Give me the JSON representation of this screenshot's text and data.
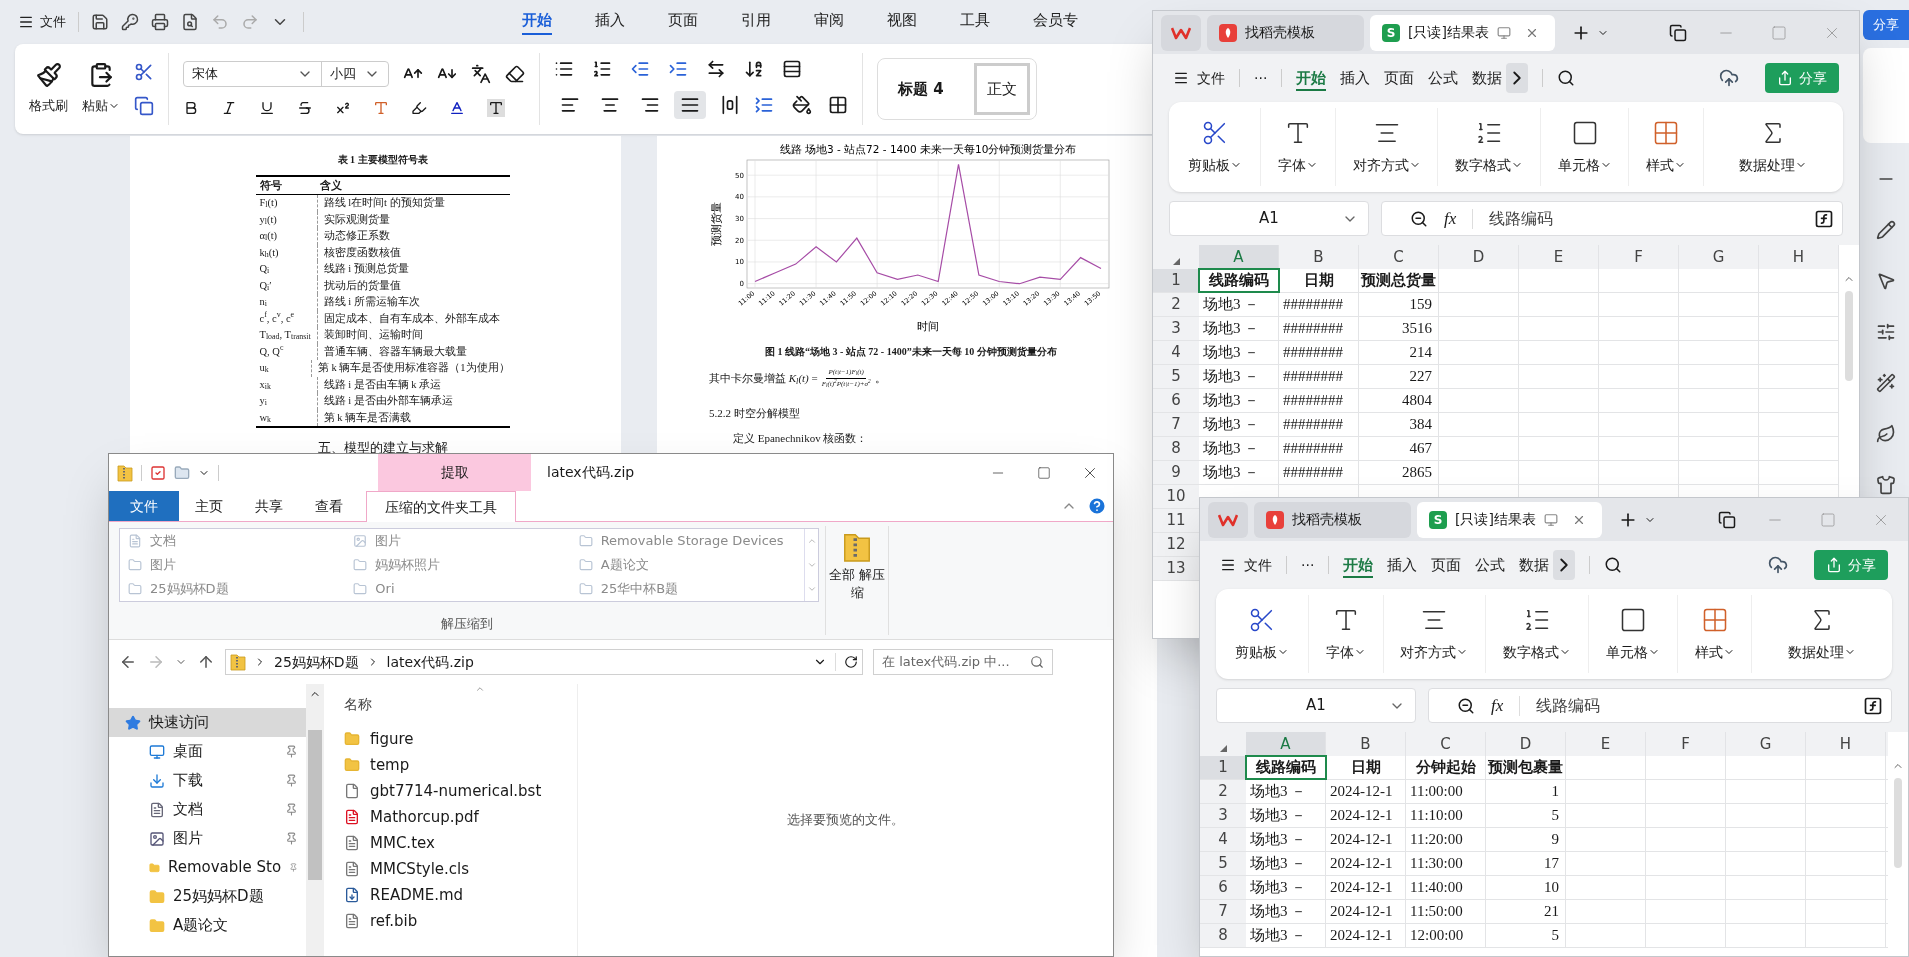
{
  "writer": {
    "menu": "文件",
    "tabs": [
      {
        "label": "开始",
        "selected": true
      },
      {
        "label": "插入",
        "selected": false
      },
      {
        "label": "页面",
        "selected": false
      },
      {
        "label": "引用",
        "selected": false
      },
      {
        "label": "审阅",
        "selected": false
      },
      {
        "label": "视图",
        "selected": false
      },
      {
        "label": "工具",
        "selected": false
      },
      {
        "label": "会员专",
        "selected": false
      }
    ],
    "clipboard": {
      "format_painter": "格式刷",
      "paste": "粘贴"
    },
    "font": "宋体",
    "size": "小四",
    "align_buttons": [
      {
        "kind": "left",
        "selected": false
      },
      {
        "kind": "center",
        "selected": false
      },
      {
        "kind": "right",
        "selected": false
      },
      {
        "kind": "justify",
        "selected": true
      },
      {
        "kind": "distributed",
        "selected": false
      }
    ],
    "styles": [
      "标题 4",
      "正文"
    ],
    "share": "分享",
    "page1": {
      "caption": "表 1  主要模型符号表",
      "columns": [
        "符号",
        "含义"
      ],
      "rows": [
        {
          "symbol": "F$_{l}$(t)",
          "meaning": "路线 l在时间t 的预知货量"
        },
        {
          "symbol": "y$_{l}$(t)",
          "meaning": "实际观测货量"
        },
        {
          "symbol": "α$_{l}$(t)",
          "meaning": "动态修正系数"
        },
        {
          "symbol": "k$_{h}$(t)",
          "meaning": "核密度函数核值"
        },
        {
          "symbol": "Q$_{i}$",
          "meaning": "线路 i 预测总货量"
        },
        {
          "symbol": "Q$_{i}$′",
          "meaning": "扰动后的货量值"
        },
        {
          "symbol": "n$_{i}$",
          "meaning": "路线 i 所需运输车次"
        },
        {
          "symbol": "c$^{f}$, c$^{v}$, c$^{e}$",
          "meaning": "固定成本、自有车成本、外部车成本"
        },
        {
          "symbol": "T$_{load}$, T$_{transit}$",
          "meaning": "装卸时间、运输时间"
        },
        {
          "symbol": "Q, Q$^{c}$",
          "meaning": "普通车辆、容器车辆最大载量"
        },
        {
          "symbol": "u$_{k}$",
          "meaning": "第 k 辆车是否使用标准容器（1为使用）"
        },
        {
          "symbol": "x$_{ik}$",
          "meaning": "线路 i 是否由车辆 k 承运"
        },
        {
          "symbol": "y$_{i}$",
          "meaning": "线路 i 是否由外部车辆承运"
        },
        {
          "symbol": "w$_{k}$",
          "meaning": "第 k 辆车是否满载"
        }
      ],
      "heading": "五、模型的建立与求解"
    },
    "page2": {
      "chart_data": {
        "type": "line",
        "title": "线路 场地3 - 站点72 - 1400 未来一天每10分钟预测货量分布",
        "xlabel": "时间",
        "ylabel": "预测货量",
        "categories": [
          "11:00",
          "11:10",
          "11:20",
          "11:30",
          "11:40",
          "11:50",
          "12:00",
          "12:10",
          "12:20",
          "12:30",
          "12:40",
          "12:50",
          "13:00",
          "13:10",
          "13:20",
          "13:30",
          "13:40",
          "13:50"
        ],
        "series": [
          {
            "color": "#a64ca6",
            "values": [
              1,
              5,
              9,
              17,
              10,
              21,
              5,
              2,
              4,
              1,
              55,
              4,
              1,
              0,
              3,
              2,
              12,
              7
            ]
          }
        ],
        "ylim": [
          -2,
          57
        ],
        "yticks": [
          0,
          10,
          20,
          30,
          40,
          50
        ],
        "grid": true
      },
      "caption": "图 1 线路“场地 3 - 站点 72 - 1400”未来一天每 10 分钟预测货量分布",
      "kalman_lead": "其中卡尔曼增益 *K$_{l}$(t)* =",
      "numerator": "P(t|t−1)F$_{l}$(t)",
      "denominator": "F$_{l}$(t)$^{2}$P(t|t−1)+σ$^{2}$",
      "kalman_end": "。",
      "section": "5.2.2 时空分解模型",
      "definition": "定义 Epanechnikov 核函数："
    }
  },
  "explorer": {
    "title": "latex代码.zip",
    "context_tab": "提取",
    "tabs": [
      {
        "label": "文件",
        "kind": "file_menu",
        "selected": false
      },
      {
        "label": "主页",
        "kind": "tab",
        "selected": false
      },
      {
        "label": "共享",
        "kind": "tab",
        "selected": false
      },
      {
        "label": "查看",
        "kind": "tab",
        "selected": false
      },
      {
        "label": "压缩的文件夹工具",
        "kind": "tab",
        "selected": true
      }
    ],
    "locations": [
      {
        "label": "文档",
        "kind": "document"
      },
      {
        "label": "图片",
        "kind": "picture"
      },
      {
        "label": "Removable Storage Devices",
        "kind": "folder"
      },
      {
        "label": "图片",
        "kind": "folder"
      },
      {
        "label": "妈妈杯照片",
        "kind": "folder"
      },
      {
        "label": "A题论文",
        "kind": "folder"
      },
      {
        "label": "25妈妈杯D题",
        "kind": "folder"
      },
      {
        "label": "Ori",
        "kind": "folder"
      },
      {
        "label": "25华中杯B题",
        "kind": "folder"
      }
    ],
    "locations_label": "解压缩到",
    "extract_all": "全部 解压缩",
    "breadcrumbs": [
      "25妈妈杯D题",
      "latex代码.zip"
    ],
    "search_placeholder": "在 latex代码.zip 中...",
    "nav": [
      {
        "label": "快速访问",
        "kind": "star",
        "selected": true,
        "pinned": false,
        "children": [
          {
            "label": "桌面",
            "kind": "desktop",
            "selected": false,
            "pinned": true
          },
          {
            "label": "下载",
            "kind": "download",
            "selected": false,
            "pinned": true
          },
          {
            "label": "文档",
            "kind": "document",
            "selected": false,
            "pinned": true
          },
          {
            "label": "图片",
            "kind": "picture",
            "selected": false,
            "pinned": true
          },
          {
            "label": "Removable Sto",
            "kind": "folder",
            "selected": false,
            "pinned": true
          },
          {
            "label": "25妈妈杯D题",
            "kind": "folder",
            "selected": false,
            "pinned": false
          },
          {
            "label": "A题论文",
            "kind": "folder",
            "selected": false,
            "pinned": false
          }
        ]
      }
    ],
    "column": "名称",
    "files": [
      {
        "name": "figure",
        "kind": "folder"
      },
      {
        "name": "temp",
        "kind": "folder"
      },
      {
        "name": "gbt7714-numerical.bst",
        "kind": "file"
      },
      {
        "name": "Mathorcup.pdf",
        "kind": "pdf"
      },
      {
        "name": "MMC.tex",
        "kind": "text"
      },
      {
        "name": "MMCStyle.cls",
        "kind": "text"
      },
      {
        "name": "README.md",
        "kind": "markdown"
      },
      {
        "name": "ref.bib",
        "kind": "text"
      }
    ],
    "preview": "选择要预览的文件。"
  },
  "sheets": [
    {
      "tabs": [
        {
          "label": "找稻壳模板",
          "kind": "template",
          "selected": false
        },
        {
          "label": "[只读]结果表",
          "kind": "sheet",
          "icon_letter": "S",
          "selected": true
        }
      ],
      "menu": "文件",
      "more": "···",
      "ribbon_tabs": [
        {
          "label": "开始",
          "selected": true
        },
        {
          "label": "插入",
          "selected": false
        },
        {
          "label": "页面",
          "selected": false
        },
        {
          "label": "公式",
          "selected": false
        },
        {
          "label": "数据",
          "selected": false
        }
      ],
      "share": "分享",
      "groups": [
        {
          "label": "剪贴板",
          "kind": "clipboard"
        },
        {
          "label": "字体",
          "kind": "font"
        },
        {
          "label": "对齐方式",
          "kind": "align"
        },
        {
          "label": "数字格式",
          "kind": "number"
        },
        {
          "label": "单元格",
          "kind": "cell"
        },
        {
          "label": "样式",
          "kind": "style"
        },
        {
          "label": "数据处理",
          "kind": "data"
        }
      ],
      "name_box": "A1",
      "fx": "fx",
      "formula": "线路编码",
      "columns": [
        {
          "label": "A",
          "selected": true
        },
        {
          "label": "B",
          "selected": false
        },
        {
          "label": "C",
          "selected": false
        },
        {
          "label": "D",
          "selected": false
        },
        {
          "label": "E",
          "selected": false
        },
        {
          "label": "F",
          "selected": false
        },
        {
          "label": "G",
          "selected": false
        },
        {
          "label": "H",
          "selected": false
        }
      ],
      "rows": [
        {
          "num": "1",
          "header": true,
          "selected": true,
          "cells": [
            "线路编码",
            "日期",
            "预测总货量"
          ]
        },
        {
          "num": "2",
          "header": false,
          "selected": false,
          "cells": [
            "场地3 －",
            "########",
            "159"
          ]
        },
        {
          "num": "3",
          "header": false,
          "selected": false,
          "cells": [
            "场地3 －",
            "########",
            "3516"
          ]
        },
        {
          "num": "4",
          "header": false,
          "selected": false,
          "cells": [
            "场地3 －",
            "########",
            "214"
          ]
        },
        {
          "num": "5",
          "header": false,
          "selected": false,
          "cells": [
            "场地3 －",
            "########",
            "227"
          ]
        },
        {
          "num": "6",
          "header": false,
          "selected": false,
          "cells": [
            "场地3 －",
            "########",
            "4804"
          ]
        },
        {
          "num": "7",
          "header": false,
          "selected": false,
          "cells": [
            "场地3 －",
            "########",
            "384"
          ]
        },
        {
          "num": "8",
          "header": false,
          "selected": false,
          "cells": [
            "场地3 －",
            "########",
            "467"
          ]
        },
        {
          "num": "9",
          "header": false,
          "selected": false,
          "cells": [
            "场地3 －",
            "########",
            "2865"
          ]
        },
        {
          "num": "10",
          "selected": false
        },
        {
          "num": "11",
          "selected": false
        },
        {
          "num": "12",
          "selected": false
        },
        {
          "num": "13",
          "selected": false
        }
      ]
    },
    {
      "tabs": [
        {
          "label": "找稻壳模板",
          "kind": "template",
          "selected": false
        },
        {
          "label": "[只读]结果表",
          "kind": "sheet",
          "icon_letter": "S",
          "selected": true
        }
      ],
      "menu": "文件",
      "more": "···",
      "ribbon_tabs": [
        {
          "label": "开始",
          "selected": true
        },
        {
          "label": "插入",
          "selected": false
        },
        {
          "label": "页面",
          "selected": false
        },
        {
          "label": "公式",
          "selected": false
        },
        {
          "label": "数据",
          "selected": false
        }
      ],
      "share": "分享",
      "groups": [
        {
          "label": "剪贴板",
          "kind": "clipboard"
        },
        {
          "label": "字体",
          "kind": "font"
        },
        {
          "label": "对齐方式",
          "kind": "align"
        },
        {
          "label": "数字格式",
          "kind": "number"
        },
        {
          "label": "单元格",
          "kind": "cell"
        },
        {
          "label": "样式",
          "kind": "style"
        },
        {
          "label": "数据处理",
          "kind": "data"
        }
      ],
      "name_box": "A1",
      "fx": "fx",
      "formula": "线路编码",
      "columns": [
        {
          "label": "A",
          "selected": true
        },
        {
          "label": "B",
          "selected": false
        },
        {
          "label": "C",
          "selected": false
        },
        {
          "label": "D",
          "selected": false
        },
        {
          "label": "E",
          "selected": false
        },
        {
          "label": "F",
          "selected": false
        },
        {
          "label": "G",
          "selected": false
        },
        {
          "label": "H",
          "selected": false
        }
      ],
      "rows": [
        {
          "num": "1",
          "header": true,
          "selected": true,
          "cells": [
            "线路编码",
            "日期",
            "分钟起始",
            "预测包裹量"
          ]
        },
        {
          "num": "2",
          "header": false,
          "selected": false,
          "cells": [
            "场地3 －",
            "2024-12-1",
            "11:00:00",
            "1"
          ]
        },
        {
          "num": "3",
          "header": false,
          "selected": false,
          "cells": [
            "场地3 －",
            "2024-12-1",
            "11:10:00",
            "5"
          ]
        },
        {
          "num": "4",
          "header": false,
          "selected": false,
          "cells": [
            "场地3 －",
            "2024-12-1",
            "11:20:00",
            "9"
          ]
        },
        {
          "num": "5",
          "header": false,
          "selected": false,
          "cells": [
            "场地3 －",
            "2024-12-1",
            "11:30:00",
            "17"
          ]
        },
        {
          "num": "6",
          "header": false,
          "selected": false,
          "cells": [
            "场地3 －",
            "2024-12-1",
            "11:40:00",
            "10"
          ]
        },
        {
          "num": "7",
          "header": false,
          "selected": false,
          "cells": [
            "场地3 －",
            "2024-12-1",
            "11:50:00",
            "21"
          ]
        },
        {
          "num": "8",
          "header": false,
          "selected": false,
          "cells": [
            "场地3 －",
            "2024-12-1",
            "12:00:00",
            "5"
          ]
        }
      ]
    }
  ]
}
